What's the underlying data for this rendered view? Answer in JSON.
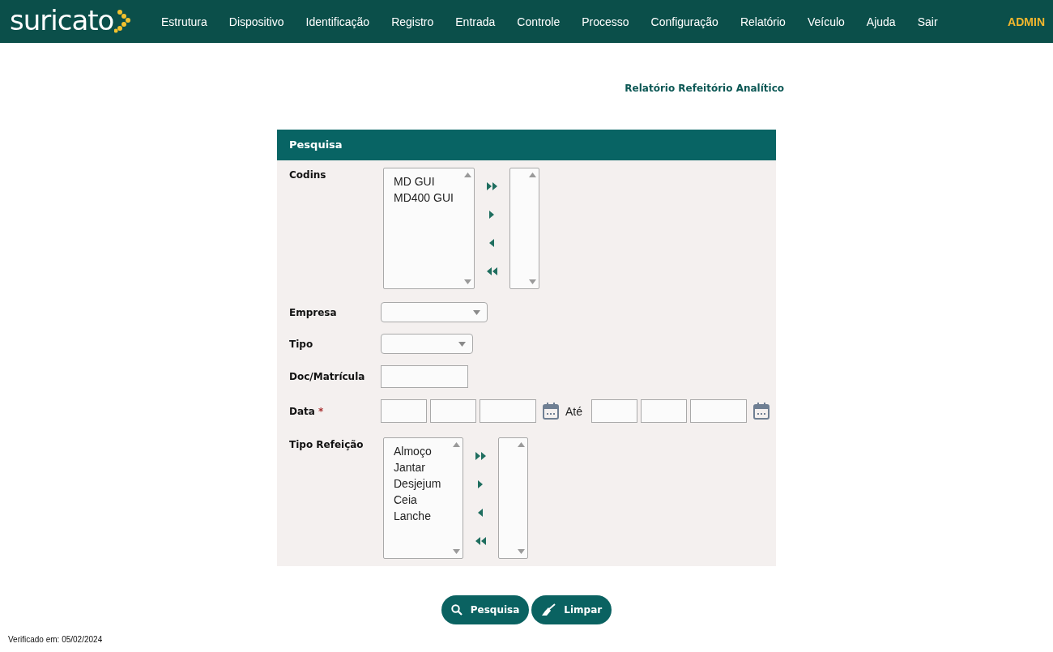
{
  "nav": {
    "logo": "suricato",
    "items": [
      "Estrutura",
      "Dispositivo",
      "Identificação",
      "Registro",
      "Entrada",
      "Controle",
      "Processo",
      "Configuração",
      "Relatório",
      "Veículo",
      "Ajuda",
      "Sair"
    ],
    "user": "ADMIN"
  },
  "page_title": "Relatório Refeitório Analítico",
  "panel": {
    "header": "Pesquisa",
    "fields": [
      {
        "kind": "dual-list",
        "label": "Codins",
        "available": [
          "MD GUI",
          "MD400 GUI"
        ]
      },
      {
        "kind": "select",
        "label": "Empresa"
      },
      {
        "kind": "select",
        "label": "Tipo"
      },
      {
        "kind": "text",
        "label": "Doc/Matrícula"
      },
      {
        "kind": "date-range",
        "label": "Data",
        "required_mark": "*",
        "separator": "Até"
      },
      {
        "kind": "dual-list",
        "label": "Tipo Refeição",
        "available": [
          "Almoço",
          "Jantar",
          "Desjejum",
          "Ceia",
          "Lanche"
        ]
      }
    ]
  },
  "buttons": [
    {
      "kind": "search",
      "label": "Pesquisa"
    },
    {
      "kind": "clear",
      "label": "Limpar"
    }
  ],
  "footer": "Verificado em: 05/02/2024"
}
